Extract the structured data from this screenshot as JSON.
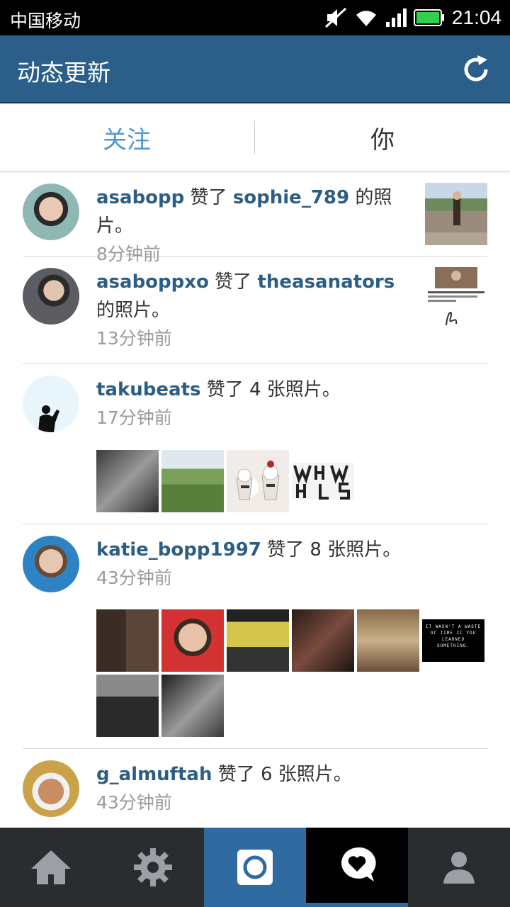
{
  "status_bar": {
    "carrier": "中国移动",
    "time": "21:04"
  },
  "header": {
    "title": "动态更新"
  },
  "tabs": [
    {
      "label": "关注"
    },
    {
      "label": "你"
    }
  ],
  "feed": [
    {
      "user": "asabopp",
      "action": "赞了",
      "target": "sophie_789",
      "suffix": "的照片。",
      "time": "8分钟前"
    },
    {
      "user": "asaboppxo",
      "action": "赞了",
      "target": "theasanators",
      "suffix": "的照片。",
      "time": "13分钟前"
    },
    {
      "user": "takubeats",
      "action": "赞了 4 张照片。",
      "time": "17分钟前"
    },
    {
      "user": "katie_bopp1997",
      "action": "赞了 8 张照片。",
      "time": "43分钟前"
    },
    {
      "user": "g_almuftah",
      "action": "赞了 6 张照片。",
      "time": "43分钟前"
    }
  ],
  "thumbnail_text": {
    "quote": "IT WASN'T A WASTE OF TIME IF YOU LEARNED SOMETHING."
  },
  "colors": {
    "header": "#2b5f8a",
    "accent_tab": "#4d97d4",
    "username": "#2c5d85",
    "nav_active": "#2f6aa0"
  },
  "icons": {
    "status": [
      "mute-icon",
      "wifi-icon",
      "signal-icon",
      "battery-icon"
    ],
    "header": "refresh-icon",
    "nav": [
      "home-icon",
      "explore-icon",
      "camera-icon",
      "activity-icon",
      "profile-icon"
    ]
  }
}
